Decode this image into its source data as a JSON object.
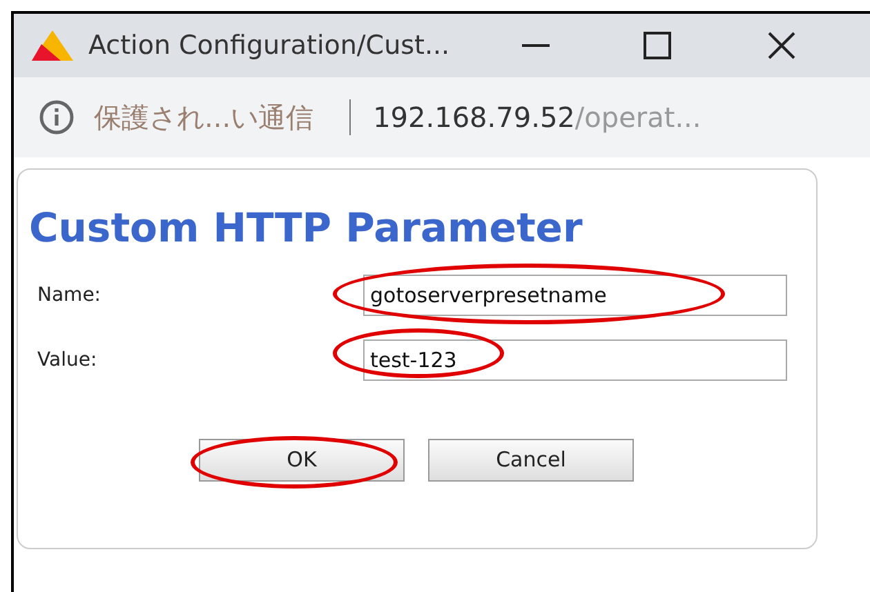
{
  "window": {
    "title": "Action Configuration/Cust..."
  },
  "address_bar": {
    "security": "保護され...い通信",
    "host": "192.168.79.52",
    "path": "/operat..."
  },
  "dialog": {
    "heading": "Custom HTTP Parameter",
    "fields": [
      {
        "label": "Name:",
        "value": "gotoserverpresetname",
        "highlighted": true
      },
      {
        "label": "Value:",
        "value": "test-123",
        "highlighted": true
      }
    ],
    "buttons": [
      {
        "label": "OK",
        "highlighted": true
      },
      {
        "label": "Cancel",
        "highlighted": false
      }
    ]
  }
}
